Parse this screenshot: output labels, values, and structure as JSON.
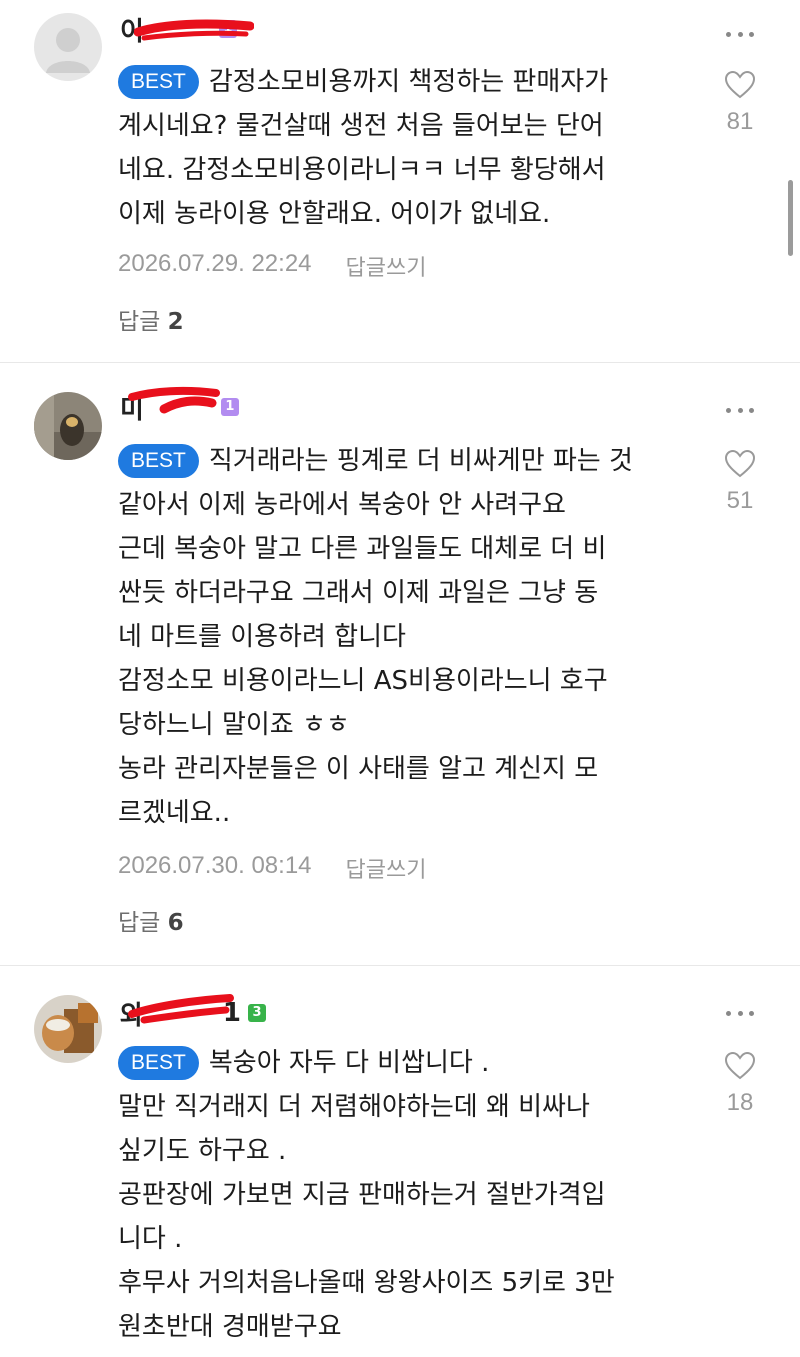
{
  "comments": [
    {
      "author_visible": "이",
      "level": "1",
      "badge": "BEST",
      "lines": [
        "감정소모비용까지 책정하는 판매자가",
        "계시네요? 물건살때 생전 처음 들어보는 단어",
        "네요. 감정소모비용이라니ㅋㅋ 너무 황당해서",
        "이제 농라이용 안할래요. 어이가 없네요."
      ],
      "timestamp": "2026.07.29. 22:24",
      "reply_write": "답글쓰기",
      "replies_label": "답글",
      "replies_count": "2",
      "likes": "81"
    },
    {
      "author_visible": "미",
      "level": "1",
      "badge": "BEST",
      "lines": [
        "직거래라는 핑계로 더 비싸게만 파는 것",
        "같아서 이제 농라에서 복숭아 안 사려구요",
        "근데 복숭아 말고 다른 과일들도 대체로 더 비",
        "싼듯 하더라구요 그래서 이제 과일은 그냥 동",
        "네 마트를 이용하려 합니다",
        "감정소모 비용이라느니 AS비용이라느니 호구",
        "당하느니 말이죠 ㅎㅎ",
        "농라 관리자분들은 이 사태를 알고 계신지 모",
        "르겠네요.."
      ],
      "timestamp": "2026.07.30. 08:14",
      "reply_write": "답글쓰기",
      "replies_label": "답글",
      "replies_count": "6",
      "likes": "51"
    },
    {
      "author_visible": "와",
      "author_suffix": "1",
      "level": "3",
      "badge": "BEST",
      "lines": [
        "복숭아 자두 다 비쌉니다 .",
        "말만 직거래지 더 저렴해야하는데 왜 비싸나",
        "싶기도 하구요 .",
        "공판장에 가보면 지금 판매하는거 절반가격입",
        "니다 .",
        "후무사 거의처음나올때 왕왕사이즈 5키로 3만",
        "원초반대 경매받구요"
      ],
      "likes": "18"
    }
  ],
  "colors": {
    "best_badge": "#1f7ae0",
    "level_purple": "#b28cf0",
    "level_green": "#38b34a",
    "meta_gray": "#9a9a9a"
  },
  "icons": [
    "more-icon",
    "heart-icon",
    "avatar-icon"
  ]
}
